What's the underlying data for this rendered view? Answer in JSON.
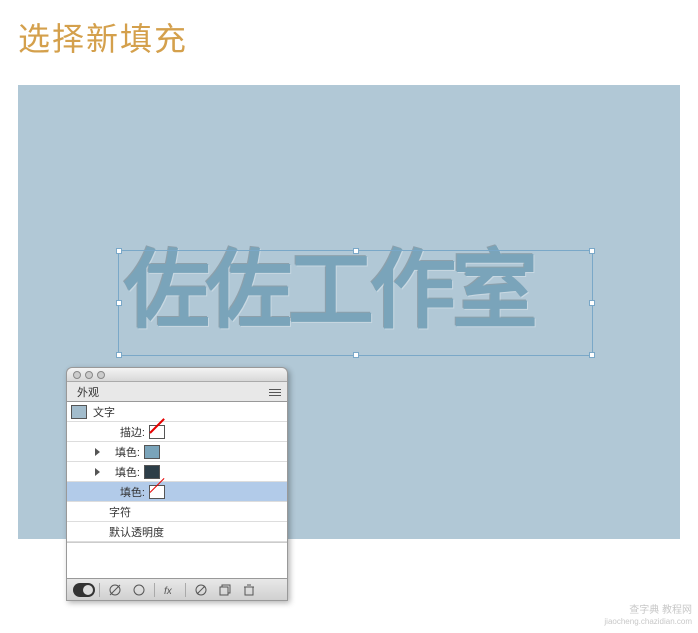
{
  "page": {
    "title": "选择新填充"
  },
  "artboard": {
    "text": "佐佐工作室"
  },
  "panel": {
    "tab_label": "外观",
    "rows": {
      "type_label": "文字",
      "stroke_label": "描边:",
      "fill1_label": "填色:",
      "fill2_label": "填色:",
      "fill3_label": "填色:",
      "char_label": "字符",
      "opacity_label": "默认透明度"
    },
    "colors": {
      "type_swatch": "#a2bccc",
      "fill1": "#7aa4ba",
      "fill2": "#2d3e48"
    }
  },
  "watermark": {
    "line1": "查字典 教程网",
    "line2": "jiaocheng.chazidian.com"
  }
}
